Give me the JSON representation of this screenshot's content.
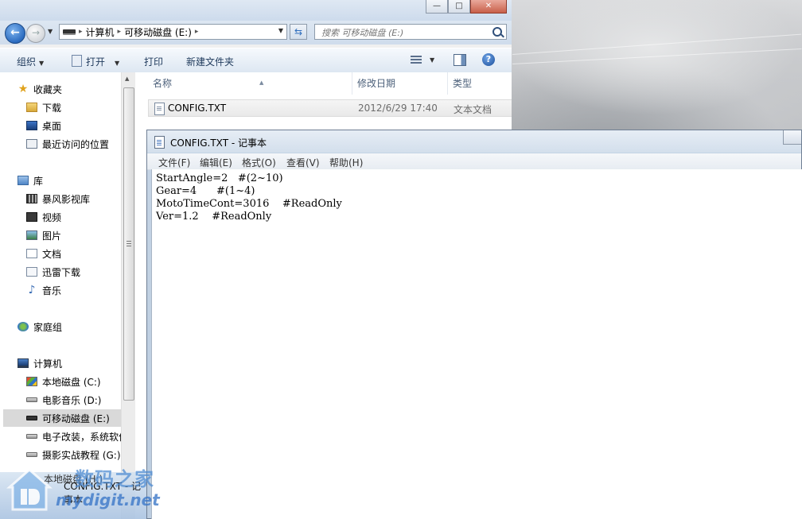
{
  "explorer": {
    "window_buttons": {
      "minimize": "—",
      "maximize": "□",
      "close": "✕"
    },
    "address": {
      "crumbs": [
        "计算机",
        "可移动磁盘 (E:)"
      ]
    },
    "search": {
      "placeholder": "搜索 可移动磁盘 (E:)"
    },
    "toolbar": {
      "organize": "组织",
      "open": "打开",
      "print": "打印",
      "new_folder": "新建文件夹",
      "help": "?"
    },
    "nav": {
      "items": [
        {
          "label": "收藏夹",
          "icon": "star-icon"
        },
        {
          "label": "下载",
          "icon": "downloads-folder-icon"
        },
        {
          "label": "桌面",
          "icon": "desktop-icon"
        },
        {
          "label": "最近访问的位置",
          "icon": "recent-places-icon"
        },
        {
          "label": "库",
          "icon": "libraries-icon"
        },
        {
          "label": "暴风影视库",
          "icon": "video-library-icon"
        },
        {
          "label": "视频",
          "icon": "videos-icon"
        },
        {
          "label": "图片",
          "icon": "pictures-icon"
        },
        {
          "label": "文档",
          "icon": "documents-icon"
        },
        {
          "label": "迅雷下载",
          "icon": "thunder-download-icon"
        },
        {
          "label": "音乐",
          "icon": "music-icon"
        },
        {
          "label": "家庭组",
          "icon": "homegroup-icon"
        },
        {
          "label": "计算机",
          "icon": "computer-icon"
        },
        {
          "label": "本地磁盘 (C:)",
          "icon": "system-drive-icon"
        },
        {
          "label": "电影音乐 (D:)",
          "icon": "drive-icon"
        },
        {
          "label": "可移动磁盘 (E:)",
          "icon": "usb-drive-icon"
        },
        {
          "label": "电子改装，系统软件",
          "icon": "drive-icon"
        },
        {
          "label": "摄影实战教程 (G:)",
          "icon": "drive-icon"
        }
      ]
    },
    "columns": {
      "name": "名称",
      "date": "修改日期",
      "type": "类型"
    },
    "files": [
      {
        "name": "CONFIG.TXT",
        "date": "2012/6/29 17:40",
        "type": "文本文档"
      }
    ]
  },
  "notepad": {
    "title": "CONFIG.TXT - 记事本",
    "menu": [
      "文件(F)",
      "编辑(E)",
      "格式(O)",
      "查看(V)",
      "帮助(H)"
    ],
    "lines": [
      "StartAngle=2   #(2~10)",
      "Gear=4      #(1~4)",
      "MotoTimeCont=3016    #ReadOnly",
      "Ver=1.2    #ReadOnly"
    ]
  },
  "thumbnail": {
    "title": "CONFIG.TXT - 记事本",
    "partial": "本地磁盘 (H:)"
  },
  "watermark": {
    "line1": "数码之家",
    "line2": "mydigit.net"
  }
}
